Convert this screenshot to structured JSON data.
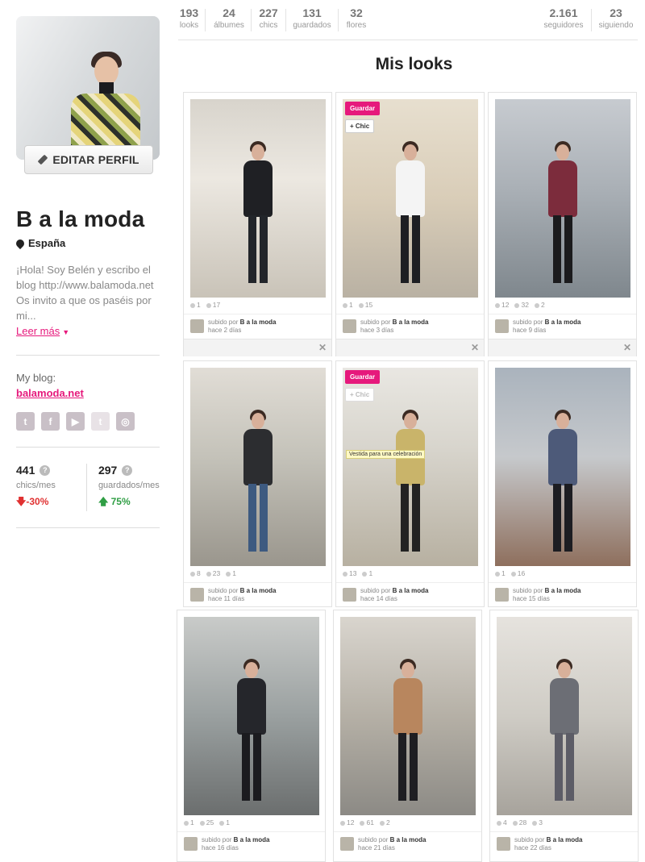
{
  "stats_left": [
    {
      "value": "193",
      "label": "looks"
    },
    {
      "value": "24",
      "label": "álbumes"
    },
    {
      "value": "227",
      "label": "chics"
    },
    {
      "value": "131",
      "label": "guardados"
    },
    {
      "value": "32",
      "label": "flores"
    }
  ],
  "stats_right": [
    {
      "value": "2.161",
      "label": "seguidores"
    },
    {
      "value": "23",
      "label": "siguiendo"
    }
  ],
  "profile": {
    "edit_button": "EDITAR PERFIL",
    "name": "B a la moda",
    "location": "España",
    "bio": "¡Hola! Soy Belén y escribo el blog http://www.balamoda.net Os invito a que os paséis por mi...",
    "read_more": "Leer más",
    "blog_label": "My blog:",
    "blog_link": "balamoda.net",
    "social": [
      "twitter-icon",
      "facebook-icon",
      "youtube-icon",
      "tumblr-icon",
      "instagram-icon"
    ]
  },
  "metrics": [
    {
      "value": "441",
      "label": "chics/mes",
      "change": "-30%",
      "direction": "down"
    },
    {
      "value": "297",
      "label": "guardados/mes",
      "change": "75%",
      "direction": "up"
    }
  ],
  "section_title": "Mis looks",
  "uploaded_by_prefix": "subido por",
  "uploader": "B a la moda",
  "save_label": "Guardar",
  "chic_label": "+ Chic",
  "tag_text": "Vestida para una celebración",
  "looks": [
    {
      "counts": [
        "1",
        "17"
      ],
      "time": "hace 2 días"
    },
    {
      "counts": [
        "1",
        "15"
      ],
      "time": "hace 3 días"
    },
    {
      "counts": [
        "12",
        "32",
        "2"
      ],
      "time": "hace 9 días"
    },
    {
      "counts": [
        "8",
        "23",
        "1"
      ],
      "time": "hace 11 días"
    },
    {
      "counts": [
        "13",
        "1"
      ],
      "time": "hace 14 días"
    },
    {
      "counts": [
        "1",
        "16"
      ],
      "time": "hace 15 días"
    },
    {
      "counts": [
        "1",
        "25",
        "1"
      ],
      "time": "hace 16 días"
    },
    {
      "counts": [
        "12",
        "61",
        "2"
      ],
      "time": "hace 21 días"
    },
    {
      "counts": [
        "4",
        "28",
        "3"
      ],
      "time": "hace 22 días"
    }
  ],
  "colors": {
    "accent": "#e6197c",
    "down": "#e03131",
    "up": "#2f9e44"
  }
}
